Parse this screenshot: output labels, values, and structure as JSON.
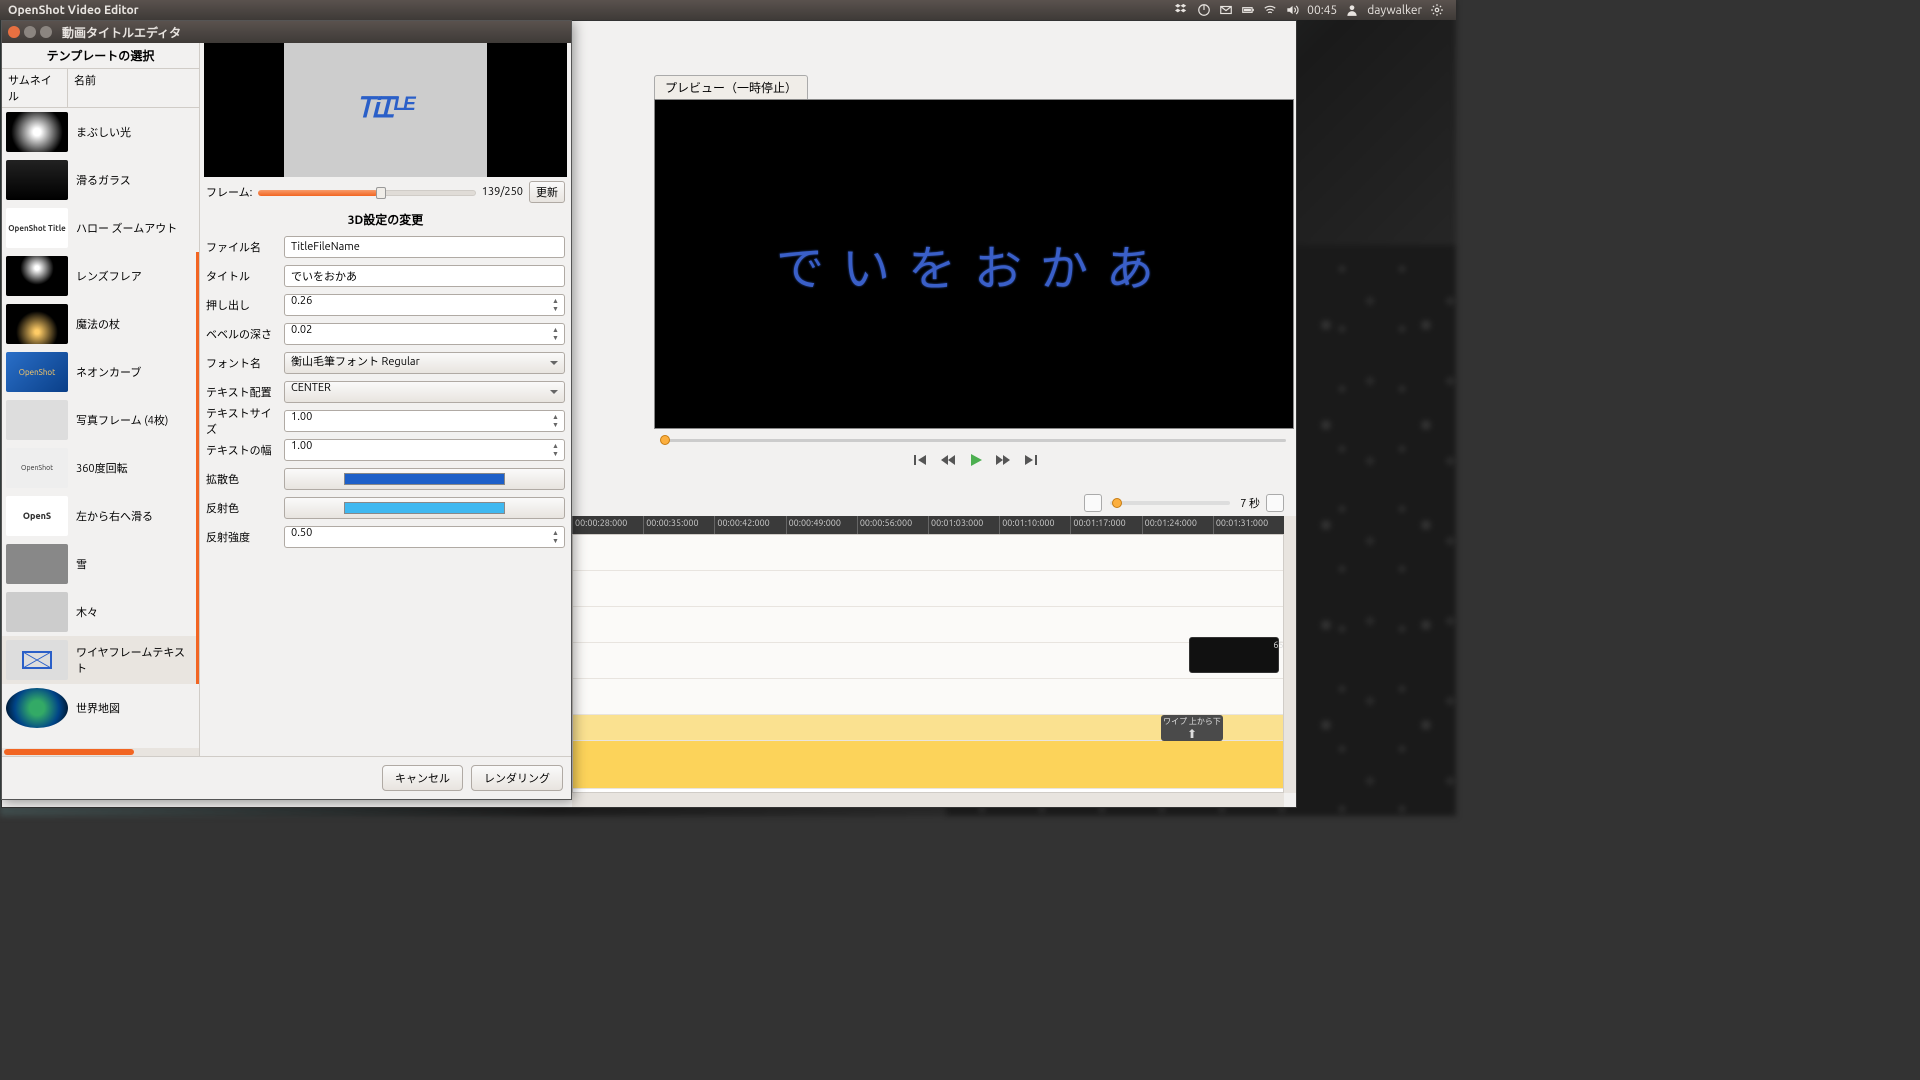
{
  "top_panel": {
    "app_name": "OpenShot Video Editor",
    "time": "00:45",
    "user": "daywalker"
  },
  "dialog": {
    "title": "動画タイトルエディタ",
    "template_header": "テンプレートの選択",
    "col_thumb": "サムネイル",
    "col_name": "名前",
    "templates": [
      {
        "name": "まぶしい光"
      },
      {
        "name": "滑るガラス"
      },
      {
        "name": "ハロー ズームアウト"
      },
      {
        "name": "レンズフレア"
      },
      {
        "name": "魔法の杖"
      },
      {
        "name": "ネオンカーブ"
      },
      {
        "name": "写真フレーム (4枚)"
      },
      {
        "name": "360度回転"
      },
      {
        "name": "左から右へ滑る"
      },
      {
        "name": "雪"
      },
      {
        "name": "木々"
      },
      {
        "name": "ワイヤフレームテキスト"
      },
      {
        "name": "世界地図"
      }
    ],
    "frame_label": "フレーム:",
    "frame_value": "139/250",
    "update_btn": "更新",
    "section_header": "3D設定の変更",
    "fields": {
      "filename_lbl": "ファイル名",
      "filename_val": "TitleFileName",
      "title_lbl": "タイトル",
      "title_val": "でいをおかあ",
      "extrude_lbl": "押し出し",
      "extrude_val": "0.26",
      "bevel_lbl": "ベベルの深さ",
      "bevel_val": "0.02",
      "font_lbl": "フォント名",
      "font_val": "衡山毛筆フォント Regular",
      "align_lbl": "テキスト配置",
      "align_val": "CENTER",
      "size_lbl": "テキストサイズ",
      "size_val": "1.00",
      "width_lbl": "テキストの幅",
      "width_val": "1.00",
      "diffuse_lbl": "拡散色",
      "diffuse_color": "#1d5fc8",
      "specular_lbl": "反射色",
      "specular_color": "#3fb8f0",
      "specint_lbl": "反射強度",
      "specint_val": "0.50"
    },
    "cancel_btn": "キャンセル",
    "render_btn": "レンダリング"
  },
  "main": {
    "preview_label": "プレビュー（一時停止）",
    "preview_text": "でいをおかあ",
    "zoom_label": "7 秒",
    "ruler": [
      "00:00:28:000",
      "00:00:35:000",
      "00:00:42:000",
      "00:00:49:000",
      "00:00:56:000",
      "00:01:03:000",
      "00:01:10:000",
      "00:01:17:000",
      "00:01:24:000",
      "00:01:31:000"
    ],
    "clip_id": "65411313",
    "transition_label": "ワイプ 上から下"
  }
}
